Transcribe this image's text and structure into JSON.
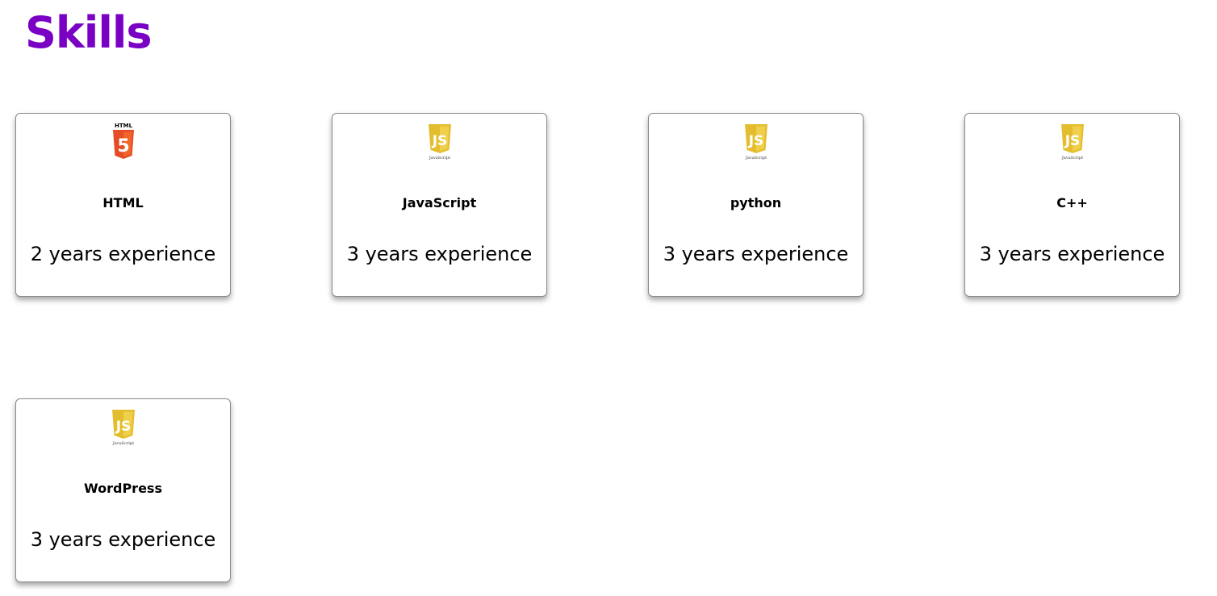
{
  "page": {
    "title": "Skills",
    "title_color": "#7a00c4"
  },
  "skills": [
    {
      "name": "HTML",
      "experience": "2 years experience",
      "icon": "html5-logo-icon",
      "logo_label": "HTML",
      "logo_glyph": "5"
    },
    {
      "name": "JavaScript",
      "experience": "3 years experience",
      "icon": "javascript-logo-icon",
      "logo_glyph": "JS",
      "logo_caption": "JavaScript"
    },
    {
      "name": "python",
      "experience": "3 years experience",
      "icon": "javascript-logo-icon",
      "logo_glyph": "JS",
      "logo_caption": "JavaScript"
    },
    {
      "name": "C++",
      "experience": "3 years experience",
      "icon": "javascript-logo-icon",
      "logo_glyph": "JS",
      "logo_caption": "JavaScript"
    },
    {
      "name": "WordPress",
      "experience": "3 years experience",
      "icon": "javascript-logo-icon",
      "logo_glyph": "JS",
      "logo_caption": "JavaScript"
    }
  ],
  "colors": {
    "html5_orange": "#e44d26",
    "html5_orange_light": "#f16529",
    "js_yellow": "#e4bd2e",
    "js_yellow_light": "#f0cf4a"
  }
}
